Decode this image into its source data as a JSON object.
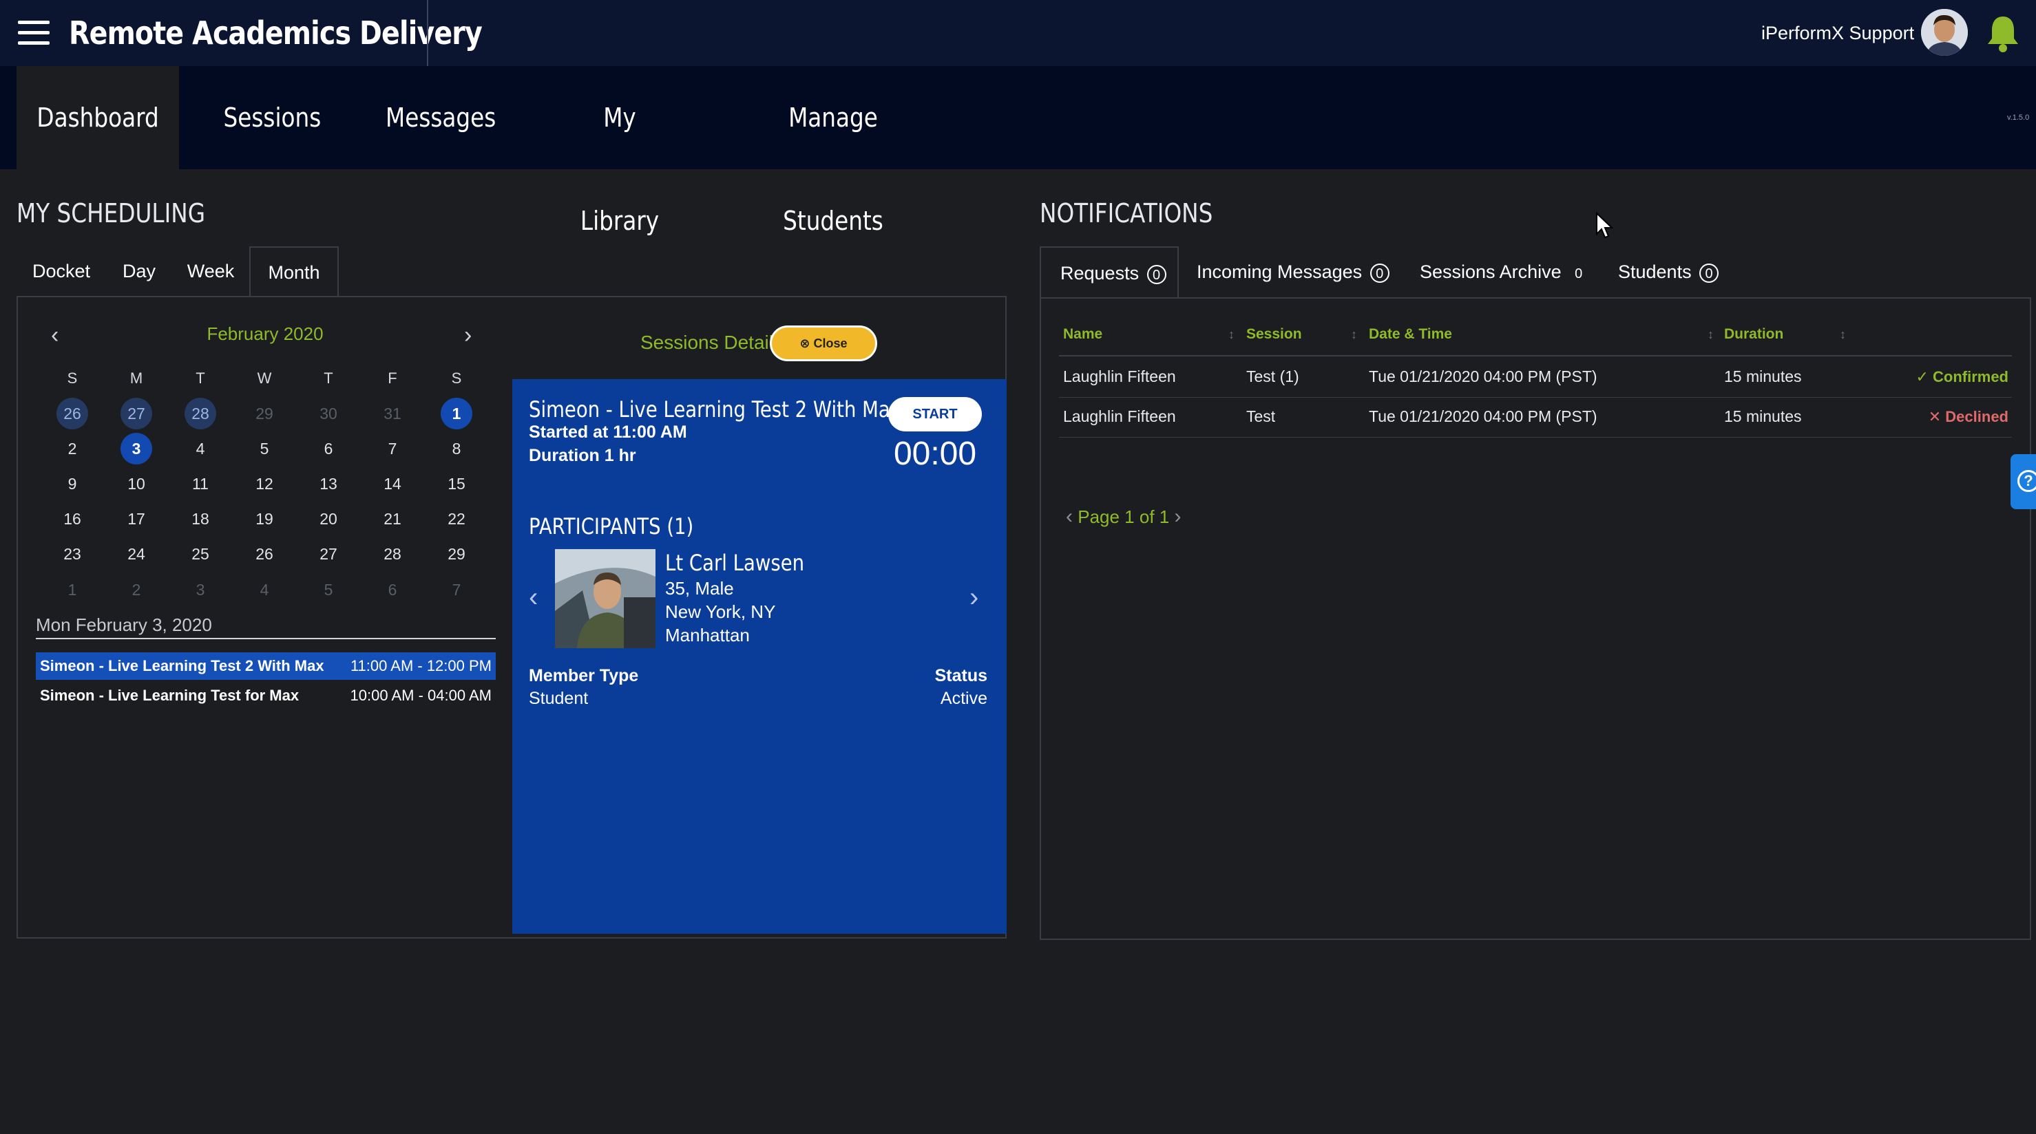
{
  "header": {
    "app_title": "Remote Academics Delivery",
    "user_name": "iPerformX Support",
    "version": "v.1.5.0"
  },
  "nav": {
    "tabs": [
      "Dashboard",
      "Sessions",
      "Messages",
      "My Library",
      "Manage Students"
    ],
    "active": "Dashboard"
  },
  "scheduling": {
    "title": "MY SCHEDULING",
    "view_tabs": [
      "Docket",
      "Day",
      "Week",
      "Month"
    ],
    "active_view": "Month",
    "calendar": {
      "month_label": "February 2020",
      "weekdays": [
        "S",
        "M",
        "T",
        "W",
        "T",
        "F",
        "S"
      ],
      "weeks": [
        [
          "26",
          "27",
          "28",
          "29",
          "30",
          "31",
          "1"
        ],
        [
          "2",
          "3",
          "4",
          "5",
          "6",
          "7",
          "8"
        ],
        [
          "9",
          "10",
          "11",
          "12",
          "13",
          "14",
          "15"
        ],
        [
          "16",
          "17",
          "18",
          "19",
          "20",
          "21",
          "22"
        ],
        [
          "23",
          "24",
          "25",
          "26",
          "27",
          "28",
          "29"
        ],
        [
          "1",
          "2",
          "3",
          "4",
          "5",
          "6",
          "7"
        ]
      ]
    },
    "selected_date_label": "Mon February 3, 2020",
    "events": [
      {
        "name": "Simeon - Live Learning Test 2 With Max",
        "time": "11:00 AM - 12:00 PM"
      },
      {
        "name": "Simeon - Live Learning Test for Max",
        "time": "10:00 AM - 04:00 AM"
      }
    ]
  },
  "session_details": {
    "title": "Sessions Details",
    "close_label": "Close",
    "session_title": "Simeon - Live Learning Test 2 With Max",
    "started": "Started at 11:00 AM",
    "duration": "Duration 1 hr",
    "start_label": "START",
    "timer": "00:00",
    "participants_title": "PARTICIPANTS (1)",
    "participant": {
      "name": "Lt Carl Lawsen",
      "age_sex": "35, Male",
      "location": "New York, NY",
      "area": "Manhattan"
    },
    "member_type_label": "Member Type",
    "member_type": "Student",
    "status_label": "Status",
    "status": "Active"
  },
  "notifications": {
    "title": "NOTIFICATIONS",
    "tabs": [
      {
        "label": "Requests",
        "count": "0"
      },
      {
        "label": "Incoming Messages",
        "count": "0"
      },
      {
        "label": "Sessions Archive",
        "count": "0"
      },
      {
        "label": "Students",
        "count": "0"
      }
    ],
    "columns": [
      "Name",
      "Session",
      "Date & Time",
      "Duration"
    ],
    "rows": [
      {
        "name": "Laughlin Fifteen",
        "session": "Test (1)",
        "datetime": "Tue 01/21/2020 04:00 PM (PST)",
        "duration": "15 minutes",
        "status": "Confirmed"
      },
      {
        "name": "Laughlin Fifteen",
        "session": "Test",
        "datetime": "Tue 01/21/2020 04:00 PM (PST)",
        "duration": "15 minutes",
        "status": "Declined"
      }
    ],
    "pager": "Page 1 of 1"
  },
  "colors": {
    "topbar": "#0c1530",
    "navbar": "#020a22",
    "accent_green": "#8fba2a",
    "card_blue": "#0a3d99",
    "close_yellow": "#f1b92a",
    "declined_red": "#e06a6a"
  }
}
